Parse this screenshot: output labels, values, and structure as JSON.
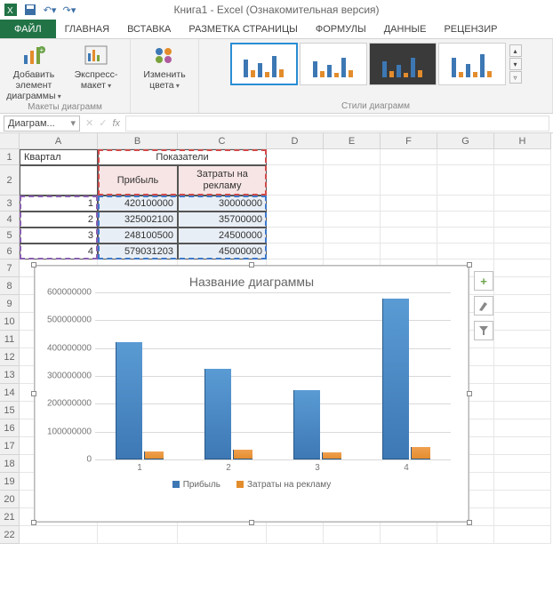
{
  "titlebar": {
    "title": "Книга1 - Excel (Ознакомительная версия)"
  },
  "qat": {
    "save": "save-icon",
    "undo": "undo-icon",
    "redo": "redo-icon"
  },
  "tabs": {
    "file": "ФАЙЛ",
    "home": "ГЛАВНАЯ",
    "insert": "ВСТАВКА",
    "layout": "РАЗМЕТКА СТРАНИЦЫ",
    "formulas": "ФОРМУЛЫ",
    "data": "ДАННЫЕ",
    "review": "РЕЦЕНЗИР"
  },
  "ribbon": {
    "add_element": "Добавить элемент диаграммы",
    "express": "Экспресс-макет",
    "group_layouts": "Макеты диаграмм",
    "change_colors": "Изменить цвета",
    "group_styles": "Стили диаграмм"
  },
  "namebox": "Диаграм...",
  "fx": "fx",
  "columns": [
    "A",
    "B",
    "C",
    "D",
    "E",
    "F",
    "G",
    "H"
  ],
  "rows": [
    "1",
    "2",
    "3",
    "4",
    "5",
    "6",
    "7",
    "8",
    "9",
    "10",
    "11",
    "12",
    "13",
    "14",
    "15",
    "16",
    "17",
    "18",
    "19",
    "20",
    "21",
    "22"
  ],
  "cells": {
    "A1": "Квартал",
    "B1": "Показатели",
    "B2": "Прибыль",
    "C2": "Затраты на рекламу",
    "A3": "1",
    "B3": "420100000",
    "C3": "30000000",
    "A4": "2",
    "B4": "325002100",
    "C4": "35700000",
    "A5": "3",
    "B5": "248100500",
    "C5": "24500000",
    "A6": "4",
    "B6": "579031203",
    "C6": "45000000"
  },
  "chart_data": {
    "type": "bar",
    "title": "Название диаграммы",
    "categories": [
      "1",
      "2",
      "3",
      "4"
    ],
    "series": [
      {
        "name": "Прибыль",
        "values": [
          420100000,
          325002100,
          248100500,
          579031203
        ],
        "color": "#3d78b4"
      },
      {
        "name": "Затраты на рекламу",
        "values": [
          30000000,
          35700000,
          24500000,
          45000000
        ],
        "color": "#e38c2c"
      }
    ],
    "ylim": [
      0,
      600000000
    ],
    "yticks": [
      0,
      100000000,
      200000000,
      300000000,
      400000000,
      500000000,
      600000000
    ],
    "xlabel": "",
    "ylabel": ""
  },
  "side": {
    "plus": "+",
    "brush": "✎",
    "filter": "▾"
  }
}
